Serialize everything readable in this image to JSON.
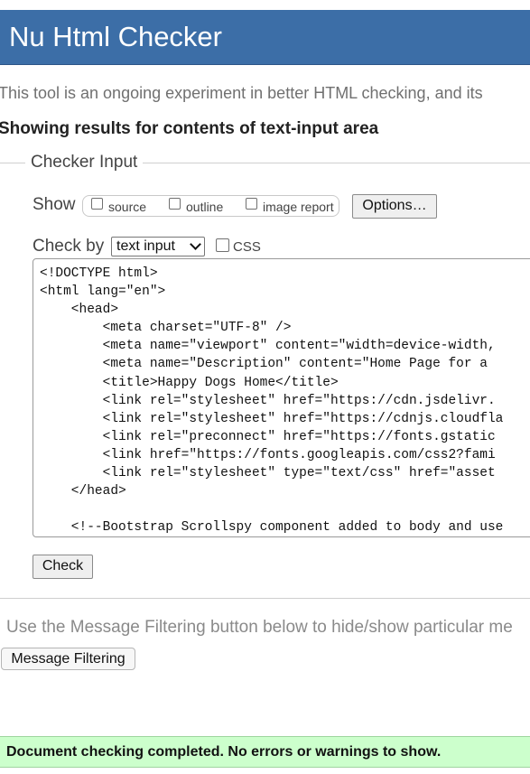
{
  "header": {
    "title": "Nu Html Checker"
  },
  "intro": {
    "text": "This tool is an ongoing experiment in better HTML checking, and its"
  },
  "results": {
    "title": "Showing results for contents of text-input area"
  },
  "checker_input": {
    "legend": "Checker Input",
    "show_label": "Show",
    "show_options": [
      {
        "label": "source",
        "checked": false
      },
      {
        "label": "outline",
        "checked": false
      },
      {
        "label": "image report",
        "checked": false
      }
    ],
    "options_button": "Options…",
    "check_by_label": "Check by",
    "check_by_value": "text input",
    "css_label": "CSS",
    "css_checked": false,
    "textarea_lines": [
      "<!DOCTYPE html>",
      "<html lang=\"en\">",
      "    <head>",
      "        <meta charset=\"UTF-8\" />",
      "        <meta name=\"viewport\" content=\"width=device-width, ",
      "        <meta name=\"Description\" content=\"Home Page for a ",
      "        <title>Happy Dogs Home</title>",
      "        <link rel=\"stylesheet\" href=\"https://cdn.jsdelivr.",
      "        <link rel=\"stylesheet\" href=\"https://cdnjs.cloudfla",
      "        <link rel=\"preconnect\" href=\"https://fonts.gstatic",
      "        <link href=\"https://fonts.googleapis.com/css2?fami",
      "        <link rel=\"stylesheet\" type=\"text/css\" href=\"asset",
      "    </head>",
      "",
      "    <!--Bootstrap Scrollspy component added to body and use"
    ],
    "check_button": "Check"
  },
  "filtering": {
    "note": "Use the Message Filtering button below to hide/show particular me",
    "button": "Message Filtering"
  },
  "status": {
    "message": "Document checking completed. No errors or warnings to show."
  },
  "colors": {
    "header_bg": "#3c6ea7",
    "success_bg": "#ccffcc"
  }
}
